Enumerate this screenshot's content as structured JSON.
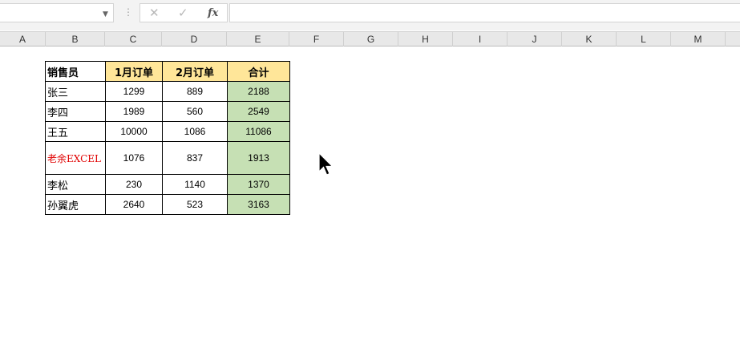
{
  "formula_bar": {
    "name_box_value": "",
    "separator": "⋮",
    "cancel_glyph": "✕",
    "enter_glyph": "✓",
    "fx_label": "fx",
    "formula_value": ""
  },
  "columns": [
    "A",
    "B",
    "C",
    "D",
    "E",
    "F",
    "G",
    "H",
    "I",
    "J",
    "K",
    "L",
    "M"
  ],
  "table": {
    "headers": [
      "销售员",
      "1月订单",
      "2月订单",
      "合计"
    ],
    "rows": [
      {
        "name": "张三",
        "jan": "1299",
        "feb": "889",
        "total": "2188"
      },
      {
        "name": "李四",
        "jan": "1989",
        "feb": "560",
        "total": "2549"
      },
      {
        "name": "王五",
        "jan": "10000",
        "feb": "1086",
        "total": "11086"
      },
      {
        "name": "老余EXCEL",
        "jan": "1076",
        "feb": "837",
        "total": "1913"
      },
      {
        "name": "李松",
        "jan": "230",
        "feb": "1140",
        "total": "1370"
      },
      {
        "name": "孙翼虎",
        "jan": "2640",
        "feb": "523",
        "total": "3163"
      }
    ]
  },
  "colors": {
    "header_fill": "#ffe699",
    "total_fill": "#c6e0b4",
    "highlight_text": "#e00000"
  },
  "icons": {
    "name_box_dropdown": "chevron-down-icon",
    "cancel": "close-icon",
    "enter": "check-icon",
    "function": "fx-icon",
    "cursor": "mouse-pointer-icon"
  }
}
